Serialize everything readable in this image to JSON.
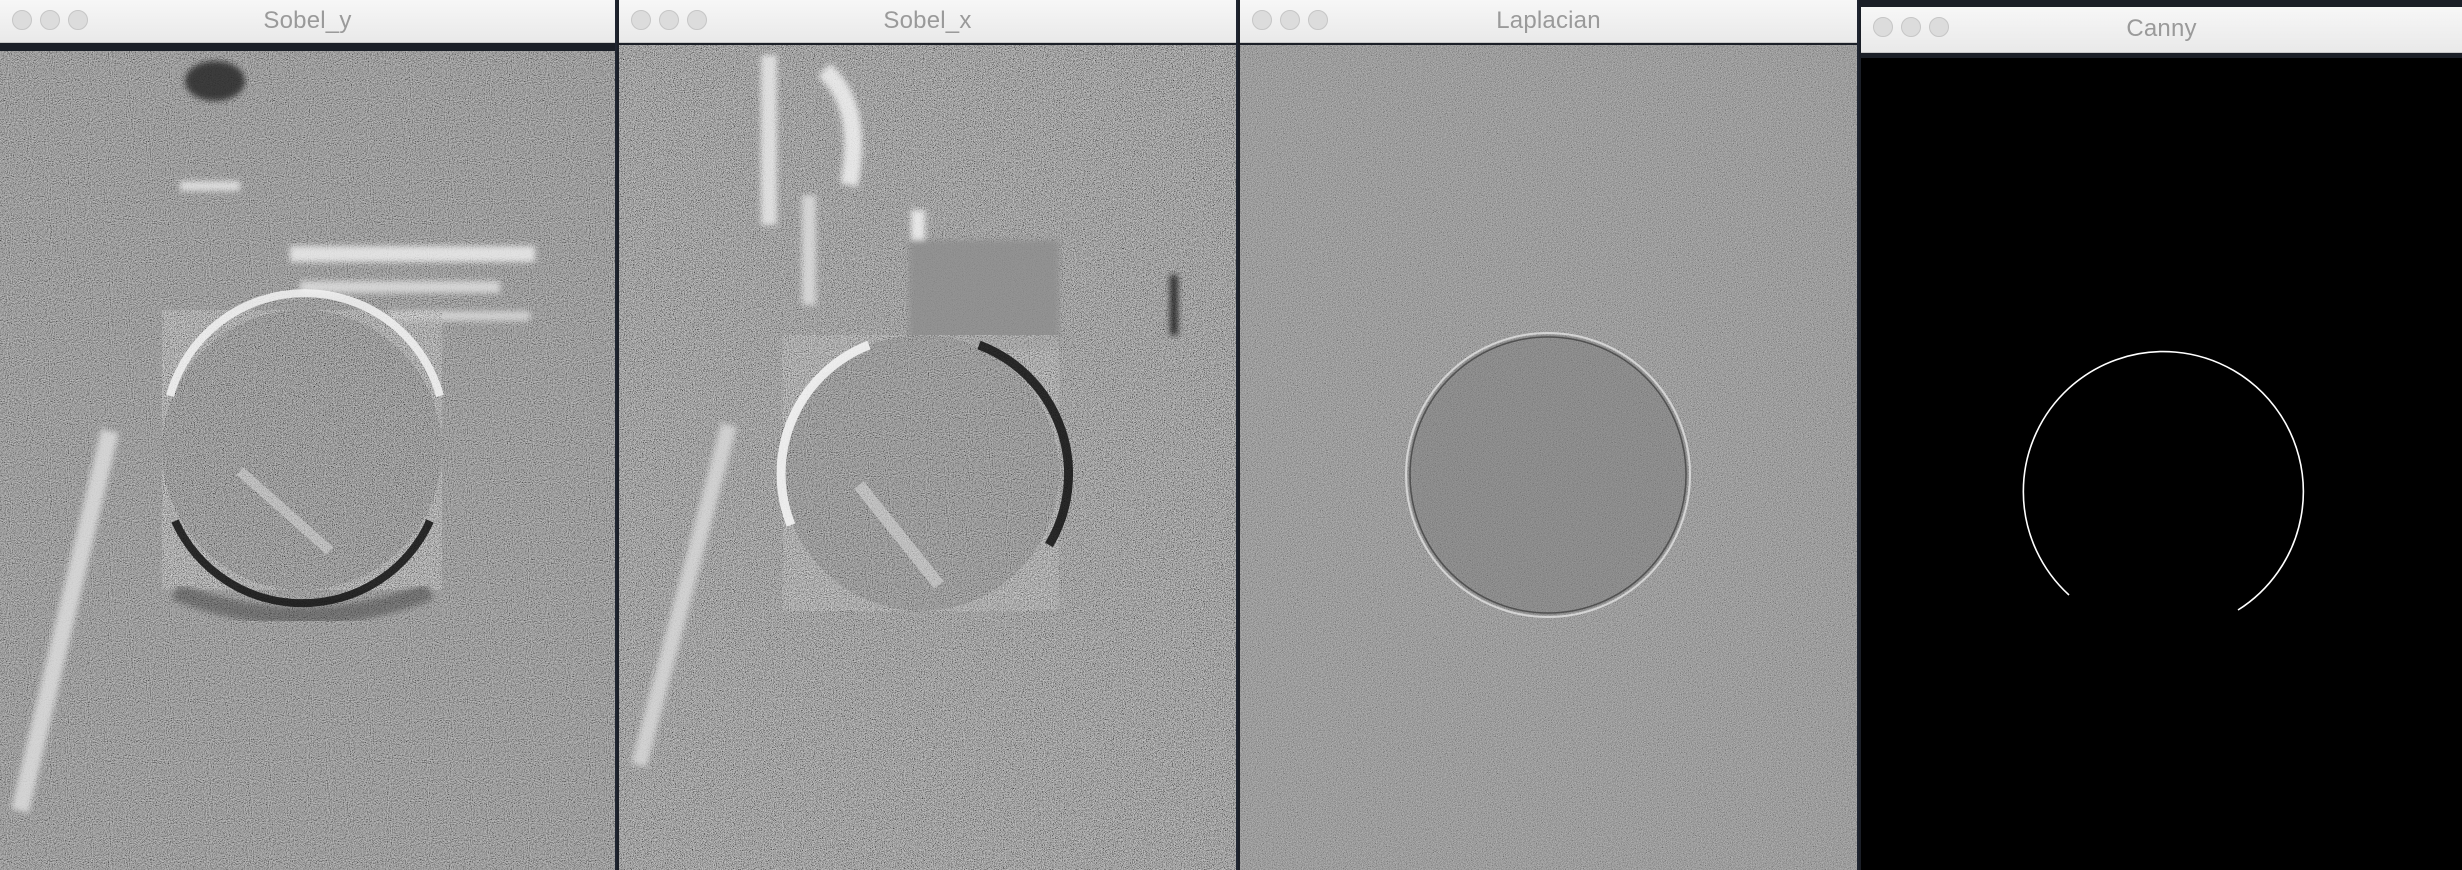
{
  "windows": [
    {
      "title": "Sobel_y"
    },
    {
      "title": "Sobel_x"
    },
    {
      "title": "Laplacian"
    },
    {
      "title": "Canny"
    }
  ]
}
